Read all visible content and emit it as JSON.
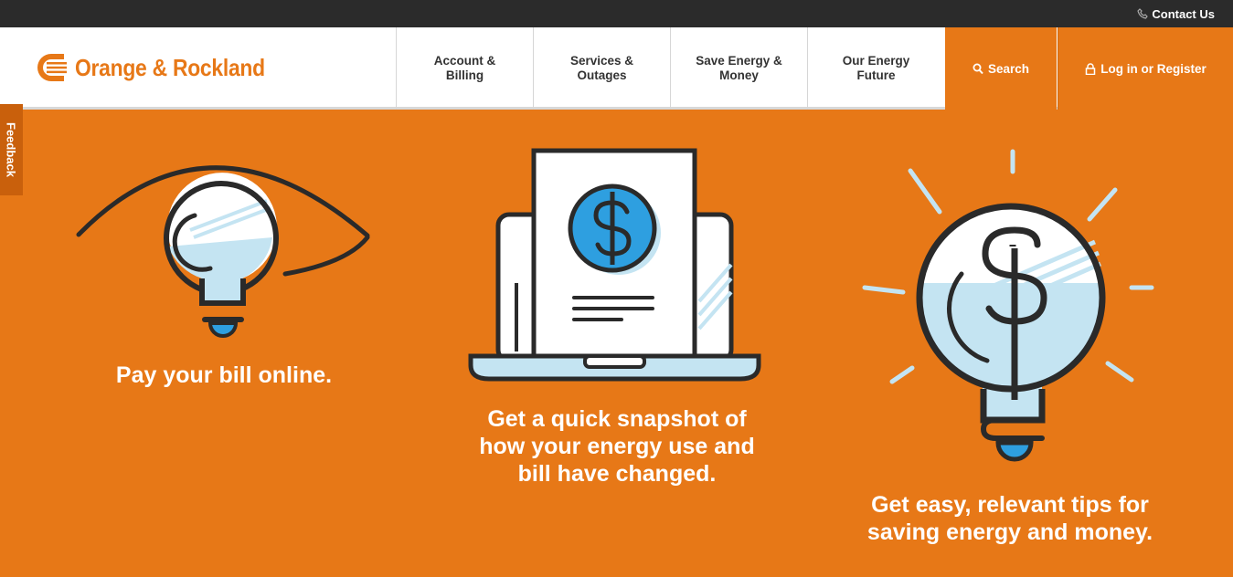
{
  "topbar": {
    "contact_label": "Contact Us"
  },
  "logo": {
    "text": "Orange & Rockland",
    "brand_color": "#e77817"
  },
  "nav": {
    "items": [
      {
        "label": "Account & Billing"
      },
      {
        "label": "Services & Outages"
      },
      {
        "label": "Save Energy & Money"
      },
      {
        "label": "Our Energy Future"
      }
    ],
    "search_label": "Search",
    "login_label": "Log in or Register"
  },
  "feedback": {
    "label": "Feedback"
  },
  "features": [
    {
      "text": "Pay your bill online.",
      "icon": "eye-lightbulb-icon"
    },
    {
      "text": "Get a quick snapshot of how your energy use and bill have changed.",
      "icon": "laptop-bill-icon"
    },
    {
      "text": "Get easy, relevant tips for saving energy and money.",
      "icon": "dollar-lightbulb-icon"
    }
  ],
  "colors": {
    "background": "#e77817",
    "topbar": "#2b2b2b",
    "light_blue": "#c4e4f2",
    "accent_blue": "#2e9fe0"
  }
}
